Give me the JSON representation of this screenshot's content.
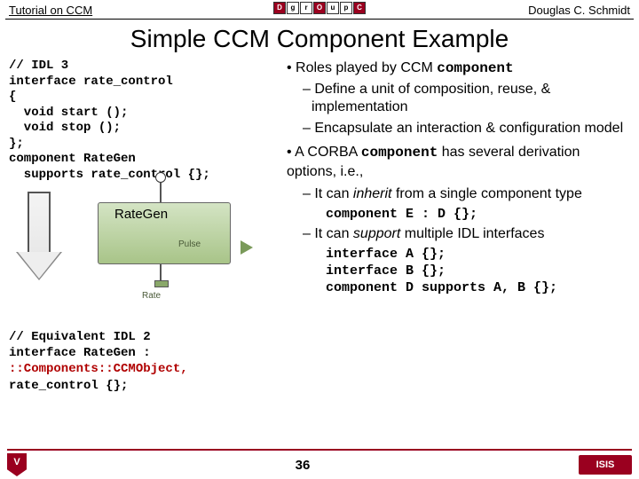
{
  "header": {
    "left": "Tutorial on CCM",
    "right": "Douglas C. Schmidt"
  },
  "title": "Simple CCM Component Example",
  "idl3": {
    "l1": "// IDL 3",
    "l2": "interface rate_control",
    "l3": "{",
    "l4": "  void start ();",
    "l5": "  void stop ();",
    "l6": "};",
    "l7": "component RateGen",
    "l8": "  supports rate_control {};"
  },
  "diagram": {
    "comp": "RateGen",
    "pulse": "Pulse",
    "rate": "Rate"
  },
  "idl2": {
    "l1": "// Equivalent IDL 2",
    "l2": "interface RateGen :",
    "l3": "  ::Components::CCMObject,",
    "l4": "  rate_control {};"
  },
  "right": {
    "b1a": "Roles played by CCM ",
    "b1b": "component",
    "sb1": "Define a unit of composition, reuse, & implementation",
    "sb2": "Encapsulate an interaction & configuration model",
    "b2a": "A CORBA ",
    "b2b": "component",
    "b2c": " has several derivation options, i.e.,",
    "sb3a": "It can ",
    "sb3b": "inherit",
    "sb3c": " from a single component type",
    "code1": "component E : D {};",
    "sb4a": "It can ",
    "sb4b": "support",
    "sb4c": " multiple IDL interfaces",
    "codeA": "interface A {};",
    "codeB": "interface B {};",
    "codeC": "component D supports A, B {};"
  },
  "footer": {
    "page": "36",
    "left_logo": "V",
    "right_logo": "ISIS"
  }
}
